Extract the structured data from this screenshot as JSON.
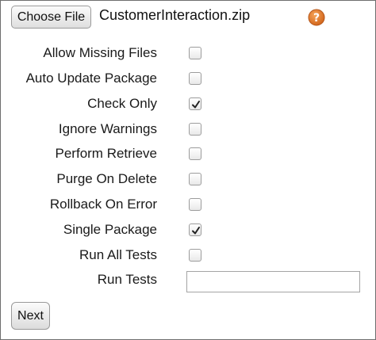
{
  "file_picker": {
    "button_label": "Choose File",
    "file_name": "CustomerInteraction.zip",
    "help_icon": "question-mark-icon",
    "help_color": "#e0782a"
  },
  "options": [
    {
      "label": "Allow Missing Files",
      "checked": false
    },
    {
      "label": "Auto Update Package",
      "checked": false
    },
    {
      "label": "Check Only",
      "checked": true
    },
    {
      "label": "Ignore Warnings",
      "checked": false
    },
    {
      "label": "Perform Retrieve",
      "checked": false
    },
    {
      "label": "Purge On Delete",
      "checked": false
    },
    {
      "label": "Rollback On Error",
      "checked": false
    },
    {
      "label": "Single Package",
      "checked": true
    },
    {
      "label": "Run All Tests",
      "checked": false
    }
  ],
  "run_tests": {
    "label": "Run Tests",
    "value": ""
  },
  "footer": {
    "next_label": "Next"
  }
}
